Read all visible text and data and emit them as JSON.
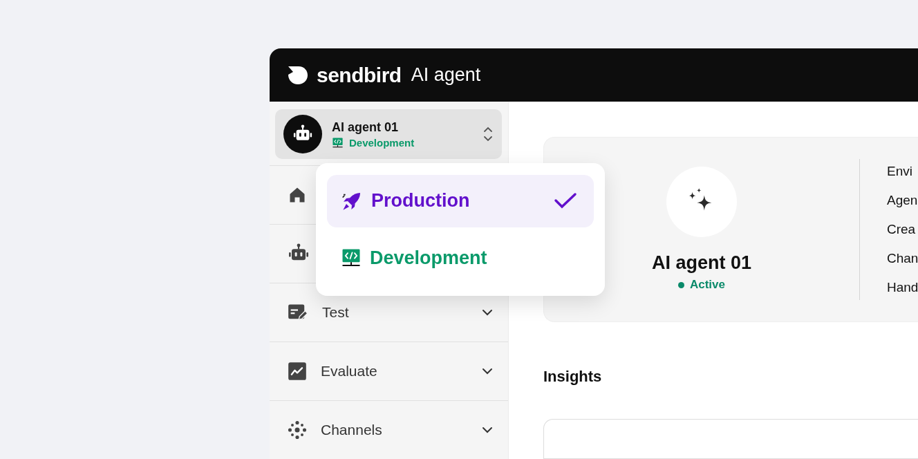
{
  "header": {
    "logo": "sendbird",
    "product": "AI agent"
  },
  "agent_switcher": {
    "name": "AI agent 01",
    "environment": "Development",
    "expanded": true
  },
  "nav_items": [
    {
      "kind": "icon"
    },
    {
      "kind": "icon"
    },
    {
      "kind": "labeled",
      "label": "Test"
    },
    {
      "kind": "labeled",
      "label": "Evaluate"
    },
    {
      "kind": "labeled",
      "label": "Channels"
    }
  ],
  "environment_menu": [
    {
      "label": "Production",
      "selected": true,
      "color": "#6210cc"
    },
    {
      "label": "Development",
      "selected": false,
      "color": "#0a9a6a"
    }
  ],
  "agent_card": {
    "name": "AI agent 01",
    "status": "Active",
    "details": [
      "Envi",
      "Agen",
      "Crea",
      "Chan",
      "Hand"
    ]
  },
  "insights": {
    "title": "Insights"
  }
}
